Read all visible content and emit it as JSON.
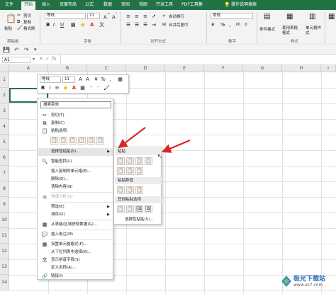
{
  "ribbon_tabs": [
    "文件",
    "开始",
    "插入",
    "页面布局",
    "公式",
    "数据",
    "审阅",
    "视图",
    "开发工具",
    "PDF工具集"
  ],
  "tell_me": "操作说明搜索",
  "clipboard": {
    "paste": "粘贴",
    "cut": "剪切",
    "copy": "复制",
    "format_painter": "格式刷",
    "label": "剪贴板"
  },
  "font": {
    "name": "等线",
    "size": "11",
    "label": "字体",
    "bold": "B",
    "italic": "I",
    "underline": "U"
  },
  "alignment": {
    "wrap": "自动换行",
    "merge": "合并后居中",
    "label": "对齐方式"
  },
  "number": {
    "format": "常规",
    "label": "数字"
  },
  "styles": {
    "conditional": "条件格式",
    "table": "套用表格格式",
    "cell": "单元格样式",
    "label": "样式"
  },
  "formula_bar": {
    "name_box": "A1"
  },
  "columns": [
    "A",
    "B",
    "C",
    "D",
    "E",
    "F",
    "G",
    "H",
    "I"
  ],
  "rows": [
    "1",
    "2",
    "3",
    "4",
    "5",
    "6",
    "7",
    "8",
    "9",
    "10",
    "11",
    "12",
    "13",
    "14"
  ],
  "mini_toolbar": {
    "font": "等线",
    "size": "11"
  },
  "context_menu": {
    "search": "搜索菜单",
    "cut": "剪切(T)",
    "copy": "复制(C)",
    "paste_options": "粘贴选项:",
    "paste_special": "选择性粘贴(S)...",
    "smart_lookup": "智能查找(L)",
    "insert_copied": "插入复制的单元格(E)...",
    "delete": "删除(D)...",
    "clear": "清除内容(N)",
    "quick_analysis": "快速分析(Q)",
    "filter": "筛选(E)",
    "sort": "排序(O)",
    "from_table": "从表格/区域获取数据(G)...",
    "insert_comment": "插入批注(M)",
    "format_cells": "设置单元格格式(F)...",
    "pick_list": "从下拉列表中选择(K)...",
    "phonetic": "显示拼音字段(S)",
    "define_name": "定义名称(A)...",
    "link": "链接(I)"
  },
  "submenu": {
    "paste": "粘贴",
    "paste_values": "粘贴数值",
    "other_paste": "其他粘贴选项",
    "paste_special": "选择性粘贴(S)..."
  },
  "watermark": {
    "title": "极光下载站",
    "url": "www.xz7.com"
  },
  "colors": {
    "excel_green": "#217346",
    "arrow_red": "#d9262b"
  }
}
